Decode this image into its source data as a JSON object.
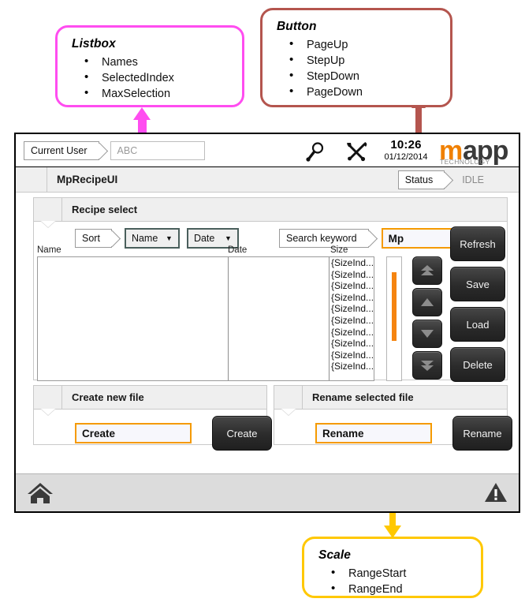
{
  "callouts": [
    {
      "id": "listbox",
      "title": "Listbox",
      "color": "#ff4df0",
      "items": [
        "Names",
        "SelectedIndex",
        "MaxSelection"
      ]
    },
    {
      "id": "button",
      "title": "Button",
      "color": "#b4554e",
      "items": [
        "PageUp",
        "StepUp",
        "StepDown",
        "PageDown"
      ]
    },
    {
      "id": "scale",
      "title": "Scale",
      "color": "#ffc800",
      "items": [
        "RangeStart",
        "RangeEnd"
      ]
    }
  ],
  "header": {
    "current_user_label": "Current User",
    "current_user_value": "ABC",
    "search_icon": "magnifier-icon",
    "tools_icon": "tools-icon",
    "time": "10:26",
    "date": "01/12/2014",
    "logo_primary": "m",
    "logo_secondary": "app",
    "logo_sub": "TECHNOLOGY"
  },
  "title_bar": {
    "title": "MpRecipeUI",
    "status_label": "Status",
    "status_value": "IDLE"
  },
  "recipe_group": {
    "heading": "Recipe select",
    "sort_label": "Sort",
    "sort_field": "Name",
    "sort_order": "Date",
    "caret": "▼",
    "search_label": "Search keyword",
    "search_value": "Mp",
    "columns": [
      "Name",
      "Date",
      "Size"
    ],
    "rows": [
      {
        "name": "",
        "date": "",
        "size": "{SizeInd..."
      },
      {
        "name": "",
        "date": "",
        "size": "{SizeInd..."
      },
      {
        "name": "",
        "date": "",
        "size": "{SizeInd..."
      },
      {
        "name": "",
        "date": "",
        "size": "{SizeInd..."
      },
      {
        "name": "",
        "date": "",
        "size": "{SizeInd..."
      },
      {
        "name": "",
        "date": "",
        "size": "{SizeInd..."
      },
      {
        "name": "",
        "date": "",
        "size": "{SizeInd..."
      },
      {
        "name": "",
        "date": "",
        "size": "{SizeInd..."
      },
      {
        "name": "",
        "date": "",
        "size": "{SizeInd..."
      },
      {
        "name": "",
        "date": "",
        "size": "{SizeInd..."
      }
    ],
    "scale": {
      "fill_color": "#f58410",
      "value_top_pct": 12,
      "value_bottom_pct": 68
    },
    "nav_buttons": [
      "page-up",
      "step-up",
      "step-down",
      "page-down"
    ],
    "actions": [
      "Refresh",
      "Save",
      "Load",
      "Delete"
    ]
  },
  "create_group": {
    "heading": "Create new file",
    "input_value": "Create",
    "button_label": "Create"
  },
  "rename_group": {
    "heading": "Rename selected file",
    "input_value": "Rename",
    "button_label": "Rename"
  },
  "footer": {
    "home_icon": "home-icon",
    "alarm_icon": "warning-triangle-icon"
  }
}
